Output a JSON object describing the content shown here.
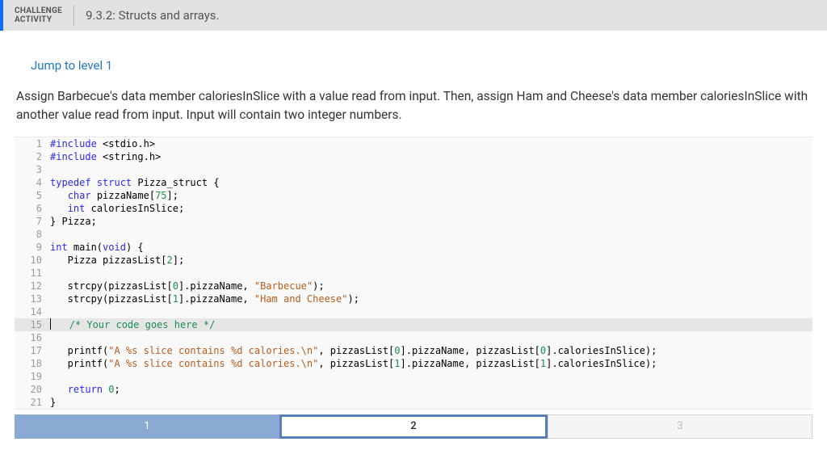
{
  "header": {
    "label_line1": "CHALLENGE",
    "label_line2": "ACTIVITY",
    "title": "9.3.2: Structs and arrays."
  },
  "jump_link": "Jump to level 1",
  "instructions": "Assign Barbecue's data member caloriesInSlice with a value read from input. Then, assign Ham and Cheese's data member caloriesInSlice with another value read from input. Input will contain two integer numbers.",
  "code": {
    "lines": [
      {
        "n": 1,
        "segs": [
          {
            "c": "kw",
            "t": "#include"
          },
          {
            "t": " <stdio.h>"
          }
        ]
      },
      {
        "n": 2,
        "segs": [
          {
            "c": "kw",
            "t": "#include"
          },
          {
            "t": " <string.h>"
          }
        ]
      },
      {
        "n": 3,
        "segs": []
      },
      {
        "n": 4,
        "segs": [
          {
            "c": "kw",
            "t": "typedef"
          },
          {
            "t": " "
          },
          {
            "c": "kw",
            "t": "struct"
          },
          {
            "t": " Pizza_struct {"
          }
        ]
      },
      {
        "n": 5,
        "segs": [
          {
            "t": "   "
          },
          {
            "c": "ty",
            "t": "char"
          },
          {
            "t": " pizzaName["
          },
          {
            "c": "num",
            "t": "75"
          },
          {
            "t": "];"
          }
        ]
      },
      {
        "n": 6,
        "segs": [
          {
            "t": "   "
          },
          {
            "c": "ty",
            "t": "int"
          },
          {
            "t": " caloriesInSlice;"
          }
        ]
      },
      {
        "n": 7,
        "segs": [
          {
            "t": "} Pizza;"
          }
        ]
      },
      {
        "n": 8,
        "segs": []
      },
      {
        "n": 9,
        "segs": [
          {
            "c": "ty",
            "t": "int"
          },
          {
            "t": " main("
          },
          {
            "c": "ty",
            "t": "void"
          },
          {
            "t": ") {"
          }
        ]
      },
      {
        "n": 10,
        "segs": [
          {
            "t": "   Pizza pizzasList["
          },
          {
            "c": "num",
            "t": "2"
          },
          {
            "t": "];"
          }
        ]
      },
      {
        "n": 11,
        "segs": []
      },
      {
        "n": 12,
        "segs": [
          {
            "t": "   strcpy(pizzasList["
          },
          {
            "c": "num",
            "t": "0"
          },
          {
            "t": "].pizzaName, "
          },
          {
            "c": "str",
            "t": "\"Barbecue\""
          },
          {
            "t": ");"
          }
        ]
      },
      {
        "n": 13,
        "segs": [
          {
            "t": "   strcpy(pizzasList["
          },
          {
            "c": "num",
            "t": "1"
          },
          {
            "t": "].pizzaName, "
          },
          {
            "c": "str",
            "t": "\"Ham and Cheese\""
          },
          {
            "t": ");"
          }
        ]
      },
      {
        "n": 14,
        "segs": []
      },
      {
        "n": 15,
        "active": true,
        "cursor": true,
        "segs": [
          {
            "t": "   "
          },
          {
            "c": "cmt",
            "t": "/* Your code goes here */"
          }
        ]
      },
      {
        "n": 16,
        "segs": []
      },
      {
        "n": 17,
        "segs": [
          {
            "t": "   printf("
          },
          {
            "c": "str",
            "t": "\"A %s slice contains %d calories.\\n\""
          },
          {
            "t": ", pizzasList["
          },
          {
            "c": "num",
            "t": "0"
          },
          {
            "t": "].pizzaName, pizzasList["
          },
          {
            "c": "num",
            "t": "0"
          },
          {
            "t": "].caloriesInSlice);"
          }
        ]
      },
      {
        "n": 18,
        "segs": [
          {
            "t": "   printf("
          },
          {
            "c": "str",
            "t": "\"A %s slice contains %d calories.\\n\""
          },
          {
            "t": ", pizzasList["
          },
          {
            "c": "num",
            "t": "1"
          },
          {
            "t": "].pizzaName, pizzasList["
          },
          {
            "c": "num",
            "t": "1"
          },
          {
            "t": "].caloriesInSlice);"
          }
        ]
      },
      {
        "n": 19,
        "segs": []
      },
      {
        "n": 20,
        "segs": [
          {
            "t": "   "
          },
          {
            "c": "kw",
            "t": "return"
          },
          {
            "t": " "
          },
          {
            "c": "num",
            "t": "0"
          },
          {
            "t": ";"
          }
        ]
      },
      {
        "n": 21,
        "segs": [
          {
            "t": "}"
          }
        ]
      }
    ]
  },
  "pagination": [
    {
      "label": "1",
      "state": "done"
    },
    {
      "label": "2",
      "state": "current"
    },
    {
      "label": "3",
      "state": "todo"
    }
  ]
}
